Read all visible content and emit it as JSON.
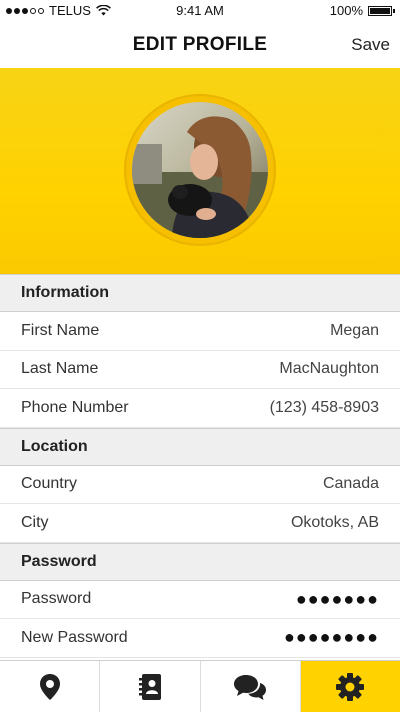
{
  "status_bar": {
    "carrier": "TELUS",
    "time": "9:41 AM",
    "battery": "100%"
  },
  "nav": {
    "title": "EDIT PROFILE",
    "save_label": "Save"
  },
  "sections": {
    "information": {
      "title": "Information",
      "first_name_label": "First Name",
      "first_name_value": "Megan",
      "last_name_label": "Last Name",
      "last_name_value": "MacNaughton",
      "phone_label": "Phone Number",
      "phone_value": "(123) 458-8903"
    },
    "location": {
      "title": "Location",
      "country_label": "Country",
      "country_value": "Canada",
      "city_label": "City",
      "city_value": "Okotoks, AB"
    },
    "password": {
      "title": "Password",
      "password_label": "Password",
      "password_value": "●●●●●●●",
      "new_password_label": "New Password",
      "new_password_value": "●●●●●●●●"
    }
  },
  "tabs": [
    {
      "icon": "location-pin-icon",
      "active": false
    },
    {
      "icon": "contacts-book-icon",
      "active": false
    },
    {
      "icon": "chat-bubbles-icon",
      "active": false
    },
    {
      "icon": "gear-icon",
      "active": true
    }
  ],
  "colors": {
    "accent": "#ffd200",
    "section_bg": "#efefef"
  }
}
